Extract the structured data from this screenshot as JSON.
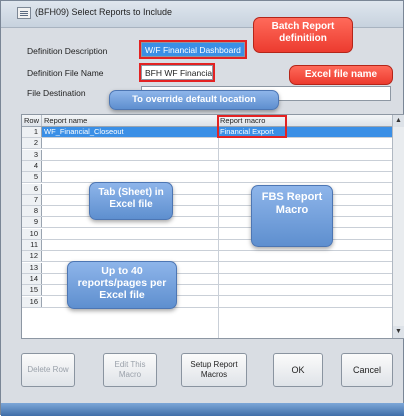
{
  "window": {
    "title": "(BFH09)  Select Reports to Include"
  },
  "fields": {
    "definition_description": {
      "label": "Definition Description",
      "value": "W/F Financial Dashboard"
    },
    "definition_file_name": {
      "label": "Definition File Name",
      "value": "BFH WF Financial"
    },
    "file_destination": {
      "label": "File Destination",
      "value": ""
    }
  },
  "callouts": {
    "batch_report": "Batch Report definitiion",
    "excel_file_name": "Excel file name",
    "override_location": "To override default location",
    "tab_sheet": "Tab (Sheet) in Excel file",
    "fbs_macro": "FBS Report Macro",
    "up_to_40": "Up to 40 reports/pages per Excel file"
  },
  "grid": {
    "headers": {
      "row": "Row",
      "report_name": "Report name",
      "report_macro": "Report macro"
    },
    "rows": [
      {
        "num": "1",
        "report_name": "WF_Financial_Closeout",
        "report_macro": "Financial Export"
      },
      {
        "num": "2",
        "report_name": "",
        "report_macro": ""
      },
      {
        "num": "3",
        "report_name": "",
        "report_macro": ""
      },
      {
        "num": "4",
        "report_name": "",
        "report_macro": ""
      },
      {
        "num": "5",
        "report_name": "",
        "report_macro": ""
      },
      {
        "num": "6",
        "report_name": "",
        "report_macro": ""
      },
      {
        "num": "7",
        "report_name": "",
        "report_macro": ""
      },
      {
        "num": "8",
        "report_name": "",
        "report_macro": ""
      },
      {
        "num": "9",
        "report_name": "",
        "report_macro": ""
      },
      {
        "num": "10",
        "report_name": "",
        "report_macro": ""
      },
      {
        "num": "11",
        "report_name": "",
        "report_macro": ""
      },
      {
        "num": "12",
        "report_name": "",
        "report_macro": ""
      },
      {
        "num": "13",
        "report_name": "",
        "report_macro": ""
      },
      {
        "num": "14",
        "report_name": "",
        "report_macro": ""
      },
      {
        "num": "15",
        "report_name": "",
        "report_macro": ""
      },
      {
        "num": "16",
        "report_name": "",
        "report_macro": ""
      }
    ]
  },
  "buttons": {
    "delete_row": "Delete Row",
    "edit_macro": "Edit This Macro",
    "setup_macros": "Setup Report Macros",
    "ok": "OK",
    "cancel": "Cancel"
  },
  "colors": {
    "selection": "#3a8fe6",
    "callout_red": "#ec3b2f",
    "callout_blue": "#5e8fcf",
    "highlight_border": "#e32222"
  }
}
